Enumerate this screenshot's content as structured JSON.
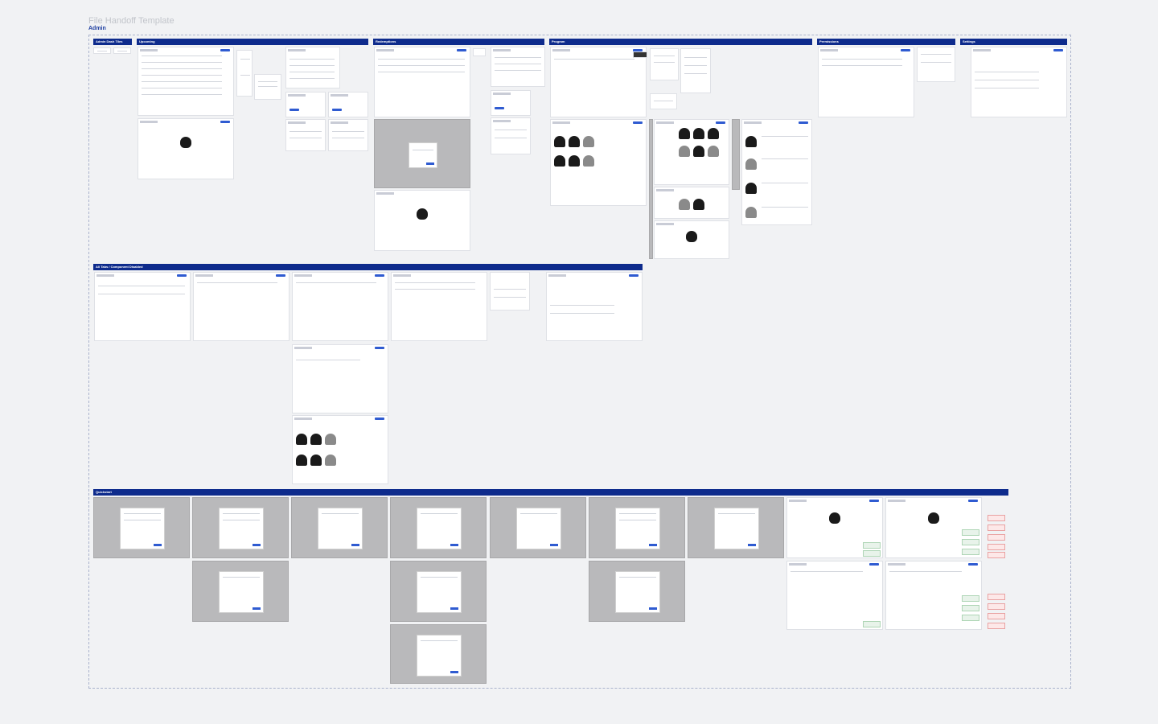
{
  "header": {
    "file_title": "File Handoff Template",
    "page_title": "Admin"
  },
  "sections": {
    "admin_dash_tiles": "Admin Dash Tiles",
    "upcoming": "Upcoming",
    "redemptions": "Redemptions",
    "program": "Program",
    "permissions": "Permissions",
    "settings": "Settings",
    "all_tabs": "All Tabs / Component Disabled",
    "quickstart": "Quickstart"
  },
  "colors": {
    "section_bar": "#0e2b8c",
    "accent": "#2f5bd1",
    "canvas": "#f1f2f4"
  }
}
